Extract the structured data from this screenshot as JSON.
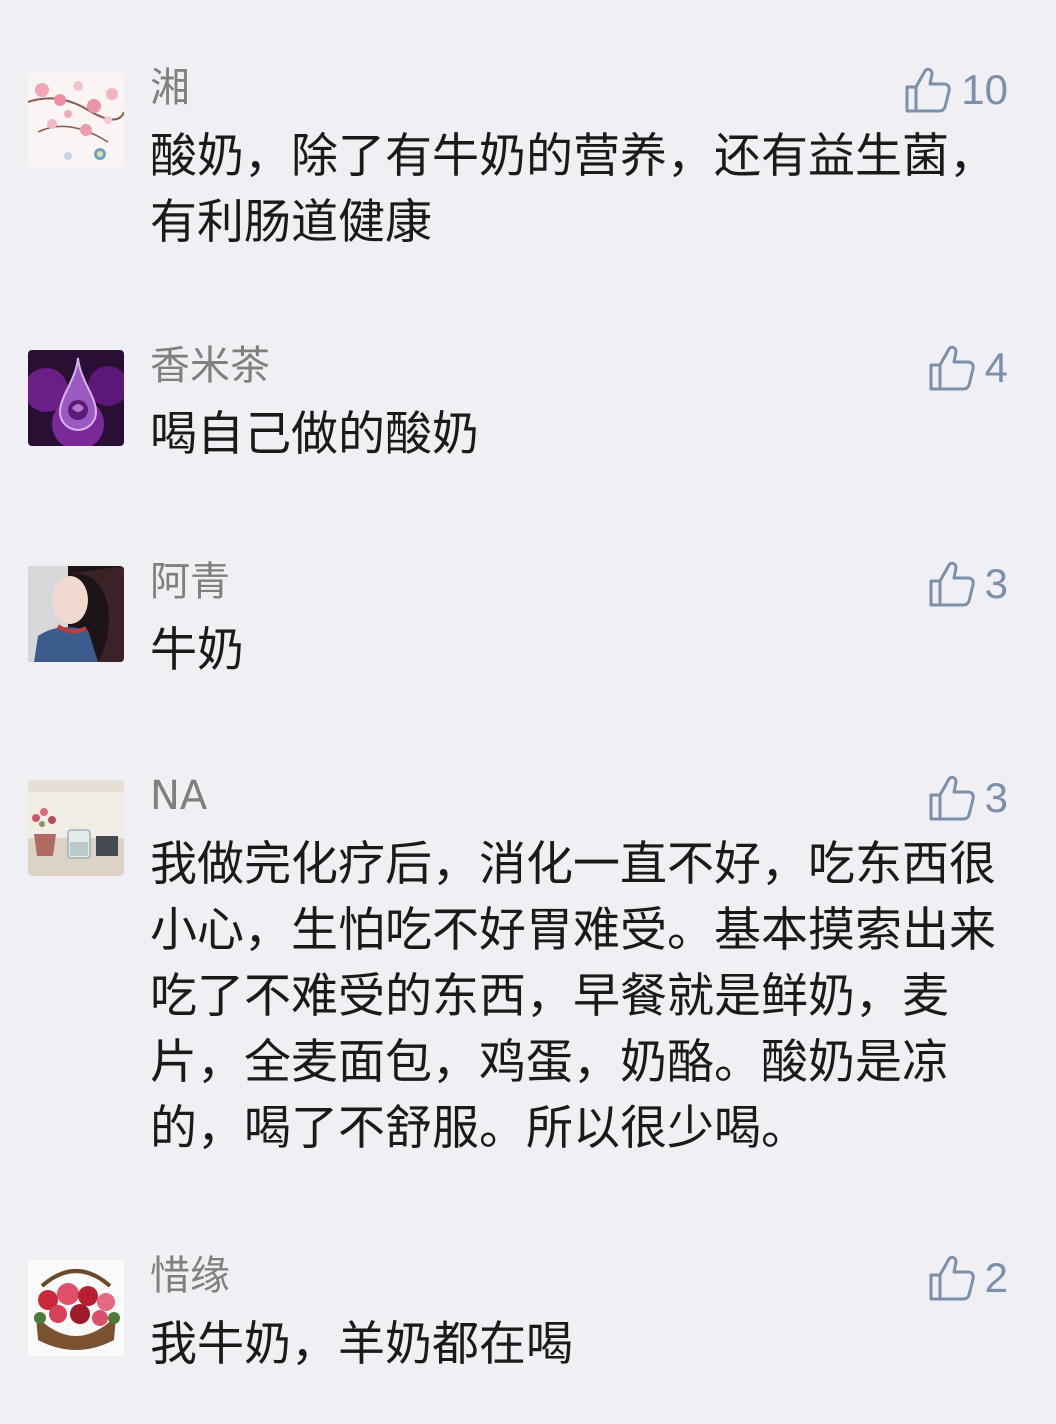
{
  "comments": [
    {
      "nickname": "湘",
      "likes": "10",
      "text": "酸奶，除了有牛奶的营养，还有益生菌，有利肠道健康",
      "avatar_icon": "pink-blossom-avatar"
    },
    {
      "nickname": "香米茶",
      "likes": "4",
      "text": "喝自己做的酸奶",
      "avatar_icon": "purple-rose-waterdrop-avatar"
    },
    {
      "nickname": "阿青",
      "likes": "3",
      "text": "牛奶",
      "avatar_icon": "girl-portrait-avatar"
    },
    {
      "nickname": "NA",
      "likes": "3",
      "text": "我做完化疗后，消化一直不好，吃东西很小心，生怕吃不好胃难受。基本摸索出来吃了不难受的东西，早餐就是鲜奶，麦片，全麦面包，鸡蛋，奶酪。酸奶是凉的，喝了不舒服。所以很少喝。",
      "avatar_icon": "flower-vase-avatar"
    },
    {
      "nickname": "惜缘",
      "likes": "2",
      "text": "我牛奶，羊奶都在喝",
      "avatar_icon": "rose-basket-avatar"
    }
  ],
  "colors": {
    "background": "#efeff4",
    "nickname": "#808080",
    "like": "#7d90a9",
    "text": "#1a1a1a"
  },
  "like_icon": "thumbs-up-icon"
}
